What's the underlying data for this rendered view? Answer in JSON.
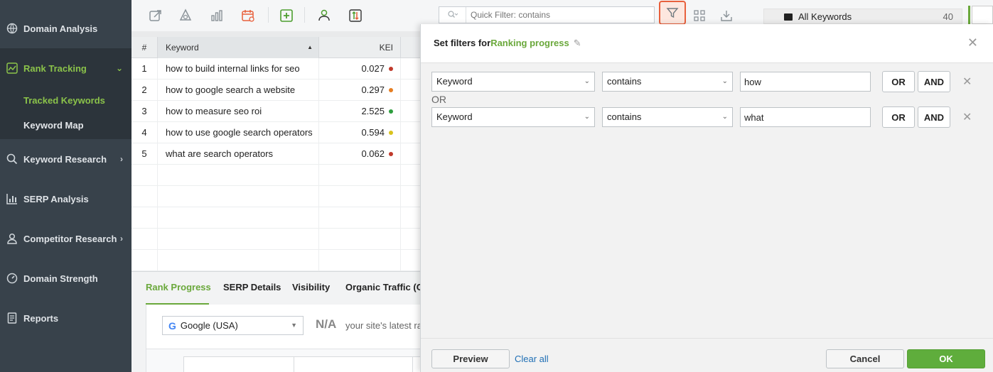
{
  "sidebar": {
    "items": [
      {
        "label": "Domain Analysis",
        "icon": "globe-icon"
      },
      {
        "label": "Rank Tracking",
        "icon": "chart-line-icon"
      },
      {
        "label": "Keyword Research",
        "icon": "search-icon"
      },
      {
        "label": "SERP Analysis",
        "icon": "bar-chart-icon"
      },
      {
        "label": "Competitor Research",
        "icon": "user-icon"
      },
      {
        "label": "Domain Strength",
        "icon": "gauge-icon"
      },
      {
        "label": "Reports",
        "icon": "document-icon"
      }
    ],
    "subitems": [
      {
        "label": "Tracked Keywords"
      },
      {
        "label": "Keyword Map"
      }
    ]
  },
  "toolbar": {
    "quick_filter_placeholder": "Quick Filter: contains"
  },
  "table": {
    "columns": [
      "#",
      "Keyword",
      "KEI"
    ],
    "rows": [
      {
        "num": "1",
        "keyword": "how to build internal links for seo",
        "kei": "0.027",
        "dot": "#c0392b"
      },
      {
        "num": "2",
        "keyword": "how to google search a website",
        "kei": "0.297",
        "dot": "#e67e22"
      },
      {
        "num": "3",
        "keyword": "how to measure seo roi",
        "kei": "2.525",
        "dot": "#2e9e3e"
      },
      {
        "num": "4",
        "keyword": "how to use google search operators",
        "kei": "0.594",
        "dot": "#d9c21c"
      },
      {
        "num": "5",
        "keyword": "what are search operators",
        "kei": "0.062",
        "dot": "#c0392b"
      }
    ]
  },
  "bottom": {
    "tabs": [
      "Rank Progress",
      "SERP Details",
      "Visibility",
      "Organic Traffic (C"
    ],
    "engine": "Google (USA)",
    "na": "N/A",
    "latest": "your site's latest ra"
  },
  "right": {
    "folder_label": "All Keywords",
    "folder_count": "40"
  },
  "dialog": {
    "title_prefix": "Set filters for",
    "project": "Ranking progress",
    "or_label": "OR",
    "rows": [
      {
        "field": "Keyword",
        "operator": "contains",
        "value": "how"
      },
      {
        "field": "Keyword",
        "operator": "contains",
        "value": "what"
      }
    ],
    "or_btn": "OR",
    "and_btn": "AND",
    "preview": "Preview",
    "clear_all": "Clear all",
    "cancel": "Cancel",
    "ok": "OK"
  },
  "colors": {
    "accent_green": "#6aa83b",
    "sidebar_bg": "#38424b",
    "filter_highlight": "#e8603c"
  }
}
